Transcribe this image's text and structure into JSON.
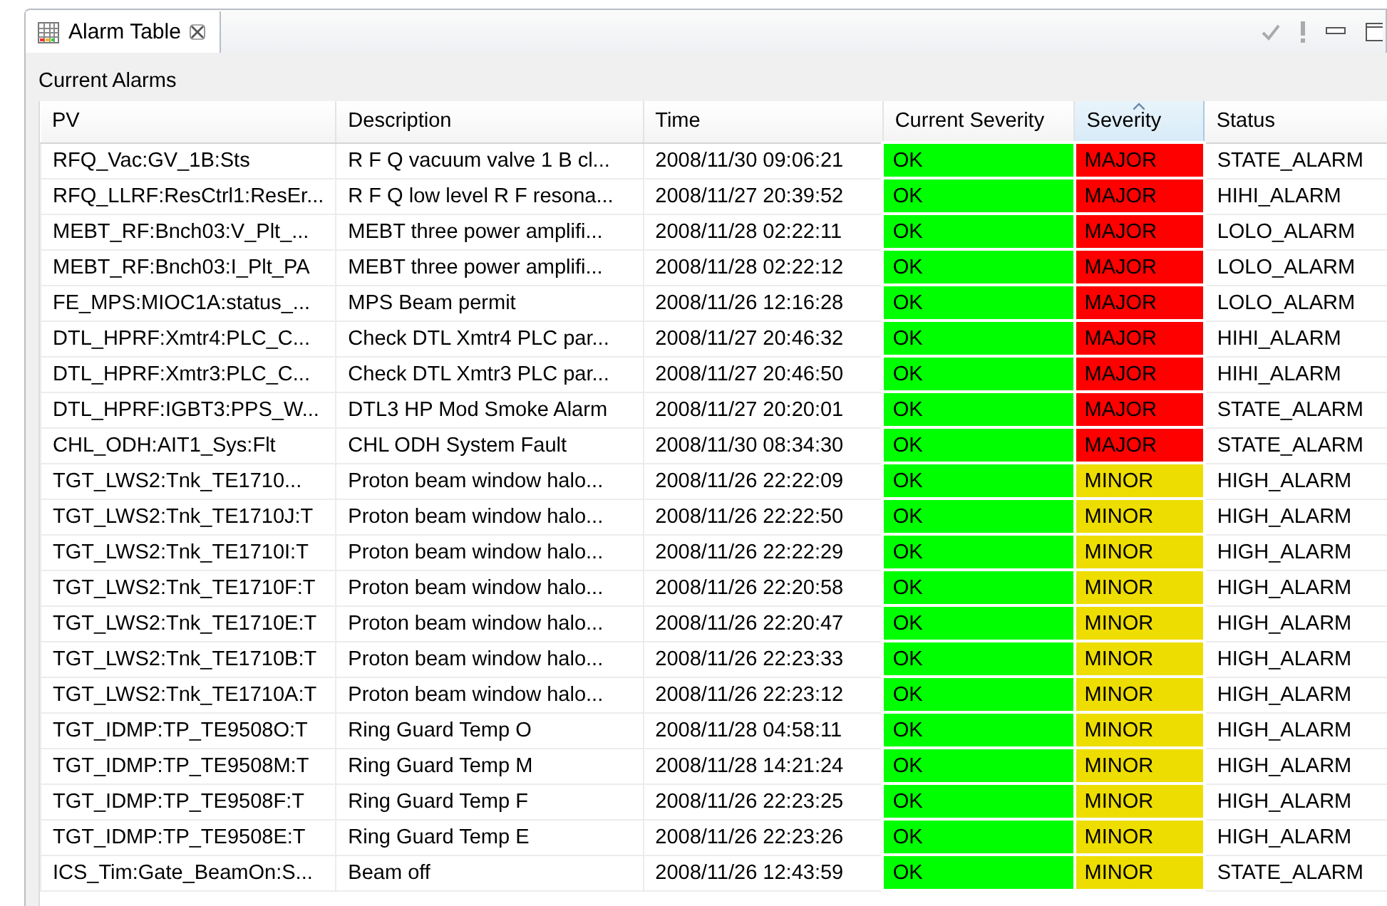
{
  "view": {
    "tab": {
      "title": "Alarm Table",
      "selected": true
    }
  },
  "section_label": "Current Alarms",
  "table": {
    "columns": [
      {
        "label": "PV",
        "sorted": false
      },
      {
        "label": "Description",
        "sorted": false
      },
      {
        "label": "Time",
        "sorted": false
      },
      {
        "label": "Current Severity",
        "sorted": false
      },
      {
        "label": "Severity",
        "sorted": true
      },
      {
        "label": "Status",
        "sorted": false
      }
    ],
    "rows": [
      {
        "pv": "RFQ_Vac:GV_1B:Sts",
        "description": "R F Q vacuum valve 1 B cl...",
        "time": "2008/11/30 09:06:21",
        "current_severity": {
          "text": "OK",
          "color": "#00ff00"
        },
        "severity": {
          "text": "MAJOR",
          "color": "#ff0000"
        },
        "status": "STATE_ALARM"
      },
      {
        "pv": "RFQ_LLRF:ResCtrl1:ResEr...",
        "description": "R F Q low level R F resona...",
        "time": "2008/11/27 20:39:52",
        "current_severity": {
          "text": "OK",
          "color": "#00ff00"
        },
        "severity": {
          "text": "MAJOR",
          "color": "#ff0000"
        },
        "status": "HIHI_ALARM"
      },
      {
        "pv": "MEBT_RF:Bnch03:V_Plt_...",
        "description": "MEBT three power amplifi...",
        "time": "2008/11/28 02:22:11",
        "current_severity": {
          "text": "OK",
          "color": "#00ff00"
        },
        "severity": {
          "text": "MAJOR",
          "color": "#ff0000"
        },
        "status": "LOLO_ALARM"
      },
      {
        "pv": "MEBT_RF:Bnch03:I_Plt_PA",
        "description": "MEBT three power amplifi...",
        "time": "2008/11/28 02:22:12",
        "current_severity": {
          "text": "OK",
          "color": "#00ff00"
        },
        "severity": {
          "text": "MAJOR",
          "color": "#ff0000"
        },
        "status": "LOLO_ALARM"
      },
      {
        "pv": "FE_MPS:MIOC1A:status_...",
        "description": "MPS Beam permit",
        "time": "2008/11/26 12:16:28",
        "current_severity": {
          "text": "OK",
          "color": "#00ff00"
        },
        "severity": {
          "text": "MAJOR",
          "color": "#ff0000"
        },
        "status": "LOLO_ALARM"
      },
      {
        "pv": "DTL_HPRF:Xmtr4:PLC_C...",
        "description": "Check DTL Xmtr4 PLC par...",
        "time": "2008/11/27 20:46:32",
        "current_severity": {
          "text": "OK",
          "color": "#00ff00"
        },
        "severity": {
          "text": "MAJOR",
          "color": "#ff0000"
        },
        "status": "HIHI_ALARM"
      },
      {
        "pv": "DTL_HPRF:Xmtr3:PLC_C...",
        "description": "Check DTL Xmtr3 PLC par...",
        "time": "2008/11/27 20:46:50",
        "current_severity": {
          "text": "OK",
          "color": "#00ff00"
        },
        "severity": {
          "text": "MAJOR",
          "color": "#ff0000"
        },
        "status": "HIHI_ALARM"
      },
      {
        "pv": "DTL_HPRF:IGBT3:PPS_W...",
        "description": "DTL3 HP Mod Smoke Alarm",
        "time": "2008/11/27 20:20:01",
        "current_severity": {
          "text": "OK",
          "color": "#00ff00"
        },
        "severity": {
          "text": "MAJOR",
          "color": "#ff0000"
        },
        "status": "STATE_ALARM"
      },
      {
        "pv": "CHL_ODH:AIT1_Sys:Flt",
        "description": "CHL ODH System Fault",
        "time": "2008/11/30 08:34:30",
        "current_severity": {
          "text": "OK",
          "color": "#00ff00"
        },
        "severity": {
          "text": "MAJOR",
          "color": "#ff0000"
        },
        "status": "STATE_ALARM"
      },
      {
        "pv": "TGT_LWS2:Tnk_TE1710...",
        "description": "Proton beam window halo...",
        "time": "2008/11/26 22:22:09",
        "current_severity": {
          "text": "OK",
          "color": "#00ff00"
        },
        "severity": {
          "text": "MINOR",
          "color": "#eedd00"
        },
        "status": "HIGH_ALARM"
      },
      {
        "pv": "TGT_LWS2:Tnk_TE1710J:T",
        "description": "Proton beam window halo...",
        "time": "2008/11/26 22:22:50",
        "current_severity": {
          "text": "OK",
          "color": "#00ff00"
        },
        "severity": {
          "text": "MINOR",
          "color": "#eedd00"
        },
        "status": "HIGH_ALARM"
      },
      {
        "pv": "TGT_LWS2:Tnk_TE1710I:T",
        "description": "Proton beam window halo...",
        "time": "2008/11/26 22:22:29",
        "current_severity": {
          "text": "OK",
          "color": "#00ff00"
        },
        "severity": {
          "text": "MINOR",
          "color": "#eedd00"
        },
        "status": "HIGH_ALARM"
      },
      {
        "pv": "TGT_LWS2:Tnk_TE1710F:T",
        "description": "Proton beam window halo...",
        "time": "2008/11/26 22:20:58",
        "current_severity": {
          "text": "OK",
          "color": "#00ff00"
        },
        "severity": {
          "text": "MINOR",
          "color": "#eedd00"
        },
        "status": "HIGH_ALARM"
      },
      {
        "pv": "TGT_LWS2:Tnk_TE1710E:T",
        "description": "Proton beam window halo...",
        "time": "2008/11/26 22:20:47",
        "current_severity": {
          "text": "OK",
          "color": "#00ff00"
        },
        "severity": {
          "text": "MINOR",
          "color": "#eedd00"
        },
        "status": "HIGH_ALARM"
      },
      {
        "pv": "TGT_LWS2:Tnk_TE1710B:T",
        "description": "Proton beam window halo...",
        "time": "2008/11/26 22:23:33",
        "current_severity": {
          "text": "OK",
          "color": "#00ff00"
        },
        "severity": {
          "text": "MINOR",
          "color": "#eedd00"
        },
        "status": "HIGH_ALARM"
      },
      {
        "pv": "TGT_LWS2:Tnk_TE1710A:T",
        "description": "Proton beam window halo...",
        "time": "2008/11/26 22:23:12",
        "current_severity": {
          "text": "OK",
          "color": "#00ff00"
        },
        "severity": {
          "text": "MINOR",
          "color": "#eedd00"
        },
        "status": "HIGH_ALARM"
      },
      {
        "pv": "TGT_IDMP:TP_TE9508O:T",
        "description": "Ring Guard Temp O",
        "time": "2008/11/28 04:58:11",
        "current_severity": {
          "text": "OK",
          "color": "#00ff00"
        },
        "severity": {
          "text": "MINOR",
          "color": "#eedd00"
        },
        "status": "HIGH_ALARM"
      },
      {
        "pv": "TGT_IDMP:TP_TE9508M:T",
        "description": "Ring Guard Temp M",
        "time": "2008/11/28 14:21:24",
        "current_severity": {
          "text": "OK",
          "color": "#00ff00"
        },
        "severity": {
          "text": "MINOR",
          "color": "#eedd00"
        },
        "status": "HIGH_ALARM"
      },
      {
        "pv": "TGT_IDMP:TP_TE9508F:T",
        "description": "Ring Guard Temp F",
        "time": "2008/11/26 22:23:25",
        "current_severity": {
          "text": "OK",
          "color": "#00ff00"
        },
        "severity": {
          "text": "MINOR",
          "color": "#eedd00"
        },
        "status": "HIGH_ALARM"
      },
      {
        "pv": "TGT_IDMP:TP_TE9508E:T",
        "description": "Ring Guard Temp E",
        "time": "2008/11/26 22:23:26",
        "current_severity": {
          "text": "OK",
          "color": "#00ff00"
        },
        "severity": {
          "text": "MINOR",
          "color": "#eedd00"
        },
        "status": "HIGH_ALARM"
      },
      {
        "pv": "ICS_Tim:Gate_BeamOn:S...",
        "description": "Beam off",
        "time": "2008/11/26 12:43:59",
        "current_severity": {
          "text": "OK",
          "color": "#00ff00"
        },
        "severity": {
          "text": "MINOR",
          "color": "#eedd00"
        },
        "status": "STATE_ALARM"
      }
    ]
  }
}
